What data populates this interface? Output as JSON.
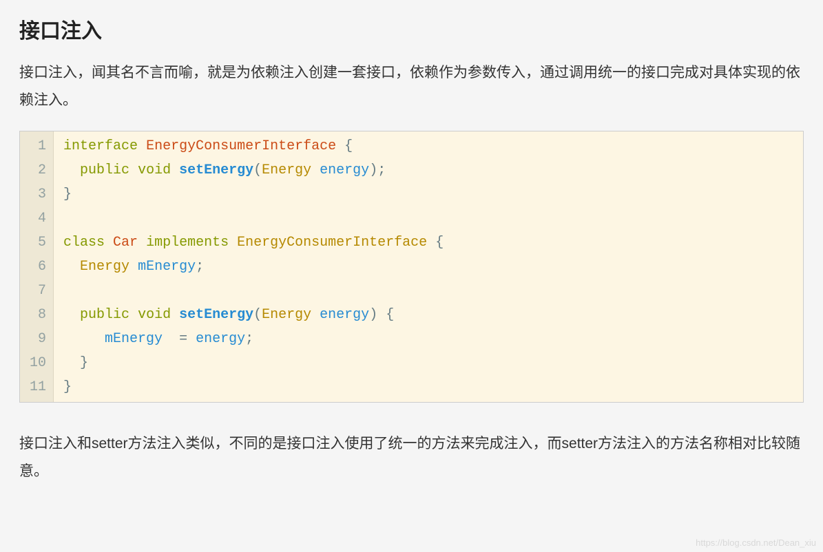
{
  "heading": "接口注入",
  "paragraph1": "接口注入，闻其名不言而喻，就是为依赖注入创建一套接口，依赖作为参数传入，通过调用统一的接口完成对具体实现的依赖注入。",
  "paragraph2": "接口注入和setter方法注入类似，不同的是接口注入使用了统一的方法来完成注入，而setter方法注入的方法名称相对比较随意。",
  "code": {
    "line_numbers": [
      "1",
      "2",
      "3",
      "4",
      "5",
      "6",
      "7",
      "8",
      "9",
      "10",
      "11"
    ],
    "tokens": {
      "interface": "interface",
      "EnergyConsumerInterface": "EnergyConsumerInterface",
      "public": "public",
      "void": "void",
      "setEnergy": "setEnergy",
      "Energy": "Energy",
      "energy": "energy",
      "class": "class",
      "Car": "Car",
      "implements": "implements",
      "mEnergy": "mEnergy"
    }
  },
  "watermark": "https://blog.csdn.net/Dean_xiu"
}
